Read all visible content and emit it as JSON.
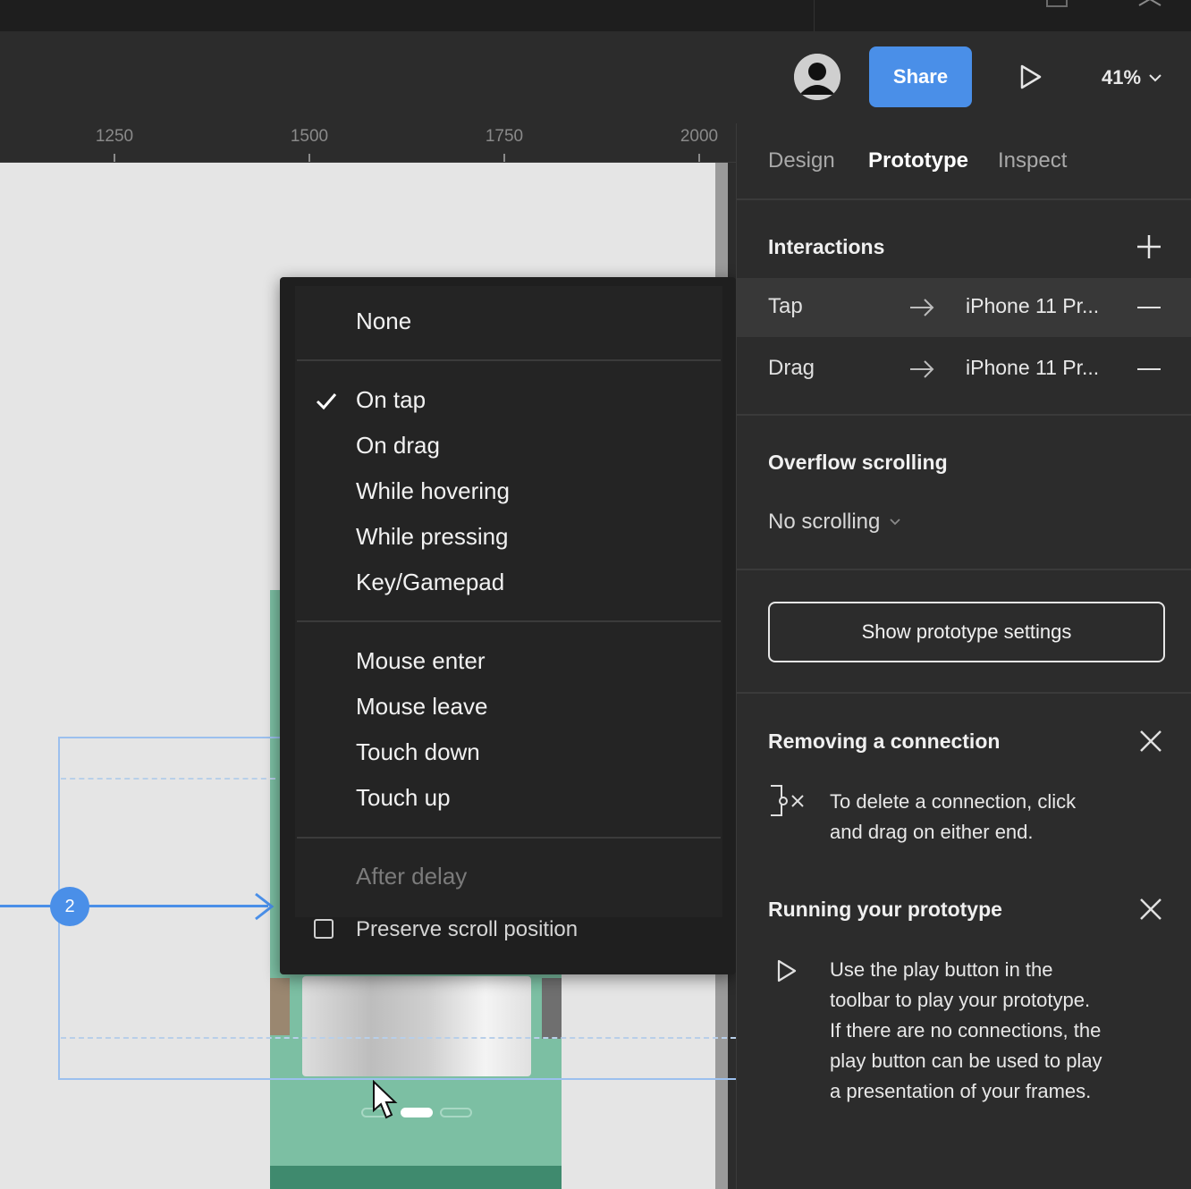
{
  "toolbar": {
    "share_label": "Share",
    "zoom_label": "41%"
  },
  "ruler": {
    "ticks": [
      "1250",
      "1500",
      "1750",
      "2000"
    ]
  },
  "canvas": {
    "flow_badge": "2"
  },
  "menu": {
    "group1": [
      "None"
    ],
    "group2": [
      "On tap",
      "On drag",
      "While hovering",
      "While pressing",
      "Key/Gamepad"
    ],
    "group3": [
      "Mouse enter",
      "Mouse leave",
      "Touch down",
      "Touch up"
    ],
    "group4": [
      "After delay"
    ],
    "selected": "On tap",
    "preserve_label": "Preserve scroll position"
  },
  "panel": {
    "tabs": [
      "Design",
      "Prototype",
      "Inspect"
    ],
    "active_tab": "Prototype",
    "interactions_title": "Interactions",
    "interactions": [
      {
        "trigger": "Tap",
        "destination": "iPhone 11 Pr..."
      },
      {
        "trigger": "Drag",
        "destination": "iPhone 11 Pr..."
      }
    ],
    "overflow_title": "Overflow scrolling",
    "overflow_value": "No scrolling",
    "settings_button": "Show prototype settings",
    "tip1": {
      "title": "Removing a connection",
      "line1": "To delete a connection, click",
      "line2": "and drag on either end."
    },
    "tip2": {
      "title": "Running your prototype",
      "line1": "Use the play button in the",
      "line2": "toolbar to play your prototype.",
      "line3": "If there are no connections, the",
      "line4": "play button can be used to play",
      "line5": "a presentation of your frames."
    }
  },
  "colors": {
    "accent": "#4a8fe8",
    "panel_bg": "#2c2c2c",
    "menu_bg": "#1f1f1f",
    "phone_green": "#7cbfa3"
  }
}
